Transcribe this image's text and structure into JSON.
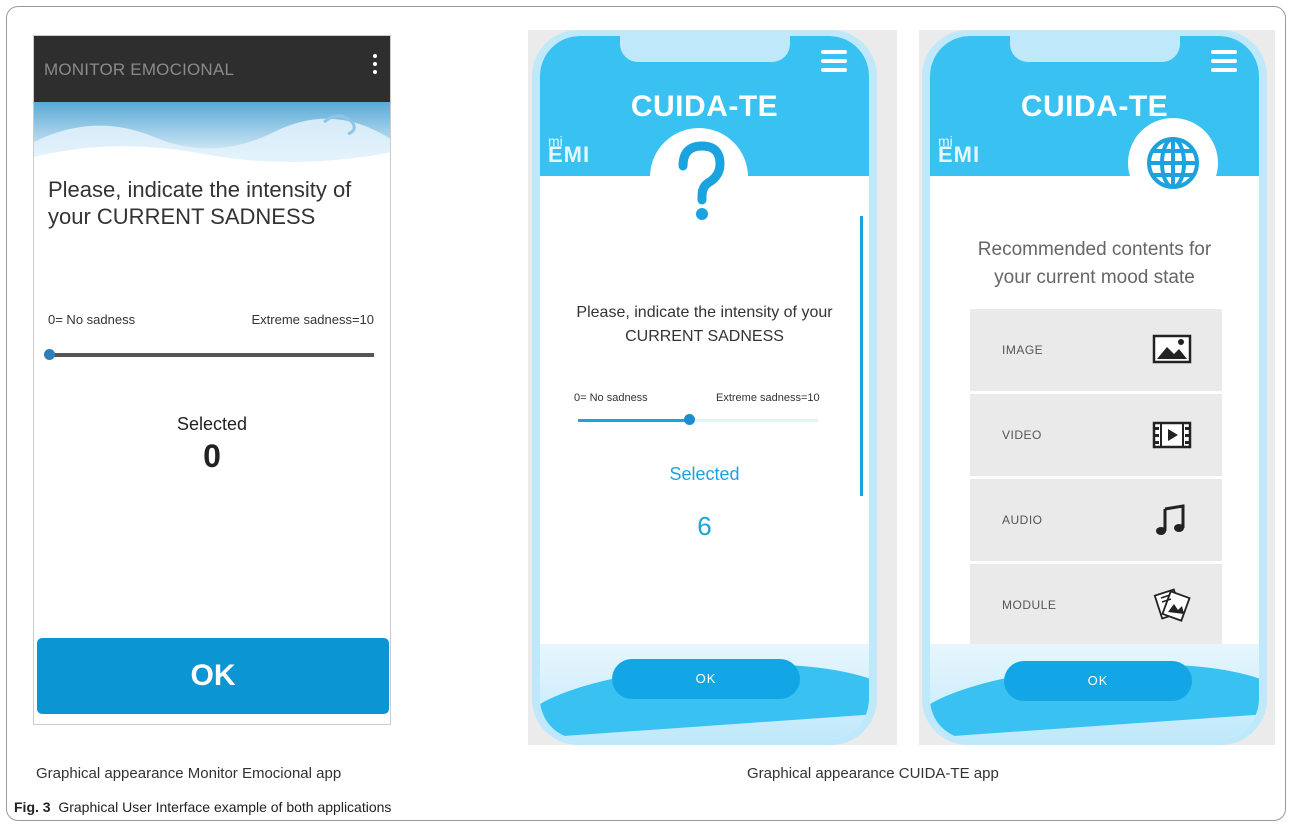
{
  "monitor": {
    "title": "MONITOR EMOCIONAL",
    "question": "Please, indicate the intensity of your CURRENT SADNESS",
    "min_label": "0= No sadness",
    "max_label": "Extreme sadness=10",
    "slider_value": 0,
    "selected_label": "Selected",
    "selected_value": "0",
    "ok_button": "OK"
  },
  "cuidate_survey": {
    "app_title": "CUIDA-TE",
    "brand_small": "mi",
    "brand_large": "EMI",
    "icon": "question-mark-icon",
    "question": "Please, indicate the intensity of your CURRENT SADNESS",
    "min_label": "0= No sadness",
    "max_label": "Extreme sadness=10",
    "slider_value": 6,
    "selected_label": "Selected",
    "selected_value": "6",
    "ok_button": "OK"
  },
  "cuidate_recommend": {
    "app_title": "CUIDA-TE",
    "brand_small": "mi",
    "brand_large": "EMI",
    "icon": "globe-icon",
    "heading": "Recommended contents for your current mood state",
    "items": [
      {
        "label": "IMAGE",
        "icon": "image-icon"
      },
      {
        "label": "VIDEO",
        "icon": "video-film-icon"
      },
      {
        "label": "AUDIO",
        "icon": "music-note-icon"
      },
      {
        "label": "MODULE",
        "icon": "module-documents-icon"
      }
    ],
    "ok_button": "OK"
  },
  "captions": {
    "left": "Graphical appearance Monitor Emocional app",
    "right": "Graphical appearance CUIDA-TE app",
    "figure_number": "Fig. 3",
    "figure_text": "Graphical User Interface example of both applications"
  },
  "colors": {
    "monitor_bar": "#2e2e2e",
    "monitor_ok": "#0c95d3",
    "cuidate_header": "#38c1f1",
    "cuidate_accent": "#1ba3e0"
  }
}
